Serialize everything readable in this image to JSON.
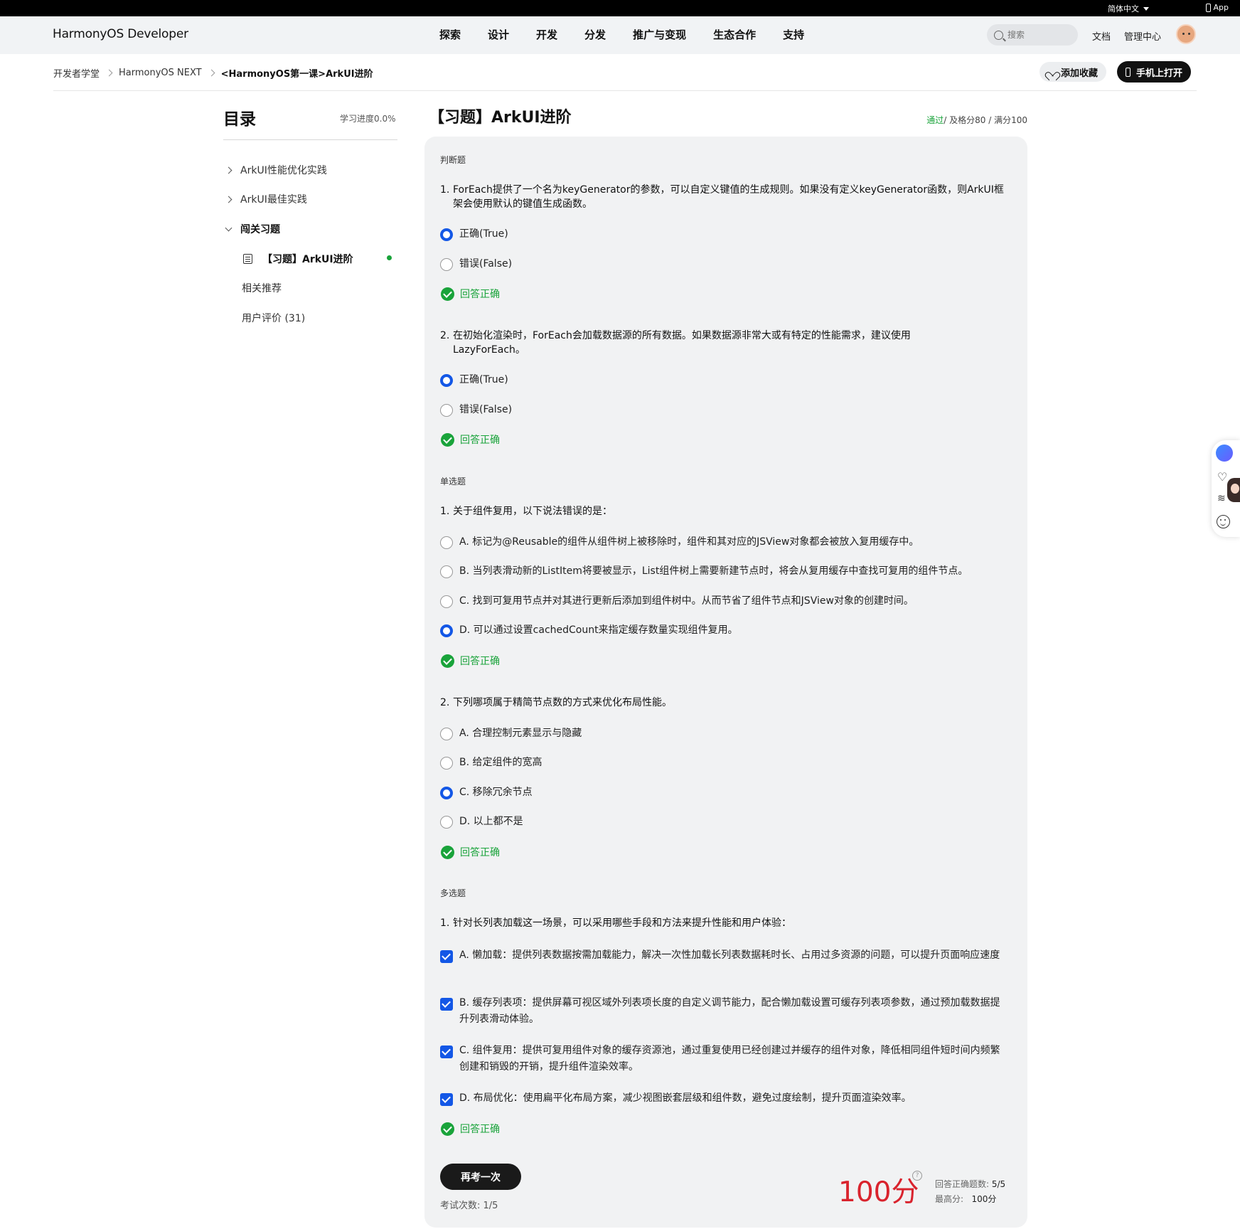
{
  "topbar": {
    "language": "简体中文",
    "app": "App"
  },
  "header": {
    "logo": "HarmonyOS Developer",
    "nav": [
      "探索",
      "设计",
      "开发",
      "分发",
      "推广与变现",
      "生态合作",
      "支持"
    ],
    "search_placeholder": "搜索",
    "docs": "文档",
    "admin": "管理中心"
  },
  "breadcrumb": [
    "开发者学堂",
    "HarmonyOS NEXT",
    "<HarmonyOS第一课>ArkUI进阶"
  ],
  "actions": {
    "favorite": "添加收藏",
    "open_mobile": "手机上打开"
  },
  "toc": {
    "title": "目录",
    "progress": "学习进度0.0%",
    "items": [
      {
        "label": "ArkUI性能优化实践"
      },
      {
        "label": "ArkUI最佳实践"
      },
      {
        "label": "闯关习题"
      },
      {
        "label": "【习题】ArkUI进阶"
      },
      {
        "label": "相关推荐"
      },
      {
        "label": "用户评价 (31)"
      }
    ]
  },
  "exam": {
    "title": "【习题】ArkUI进阶",
    "status": "通过",
    "pass_line": "/ 及格分80",
    "full_score": "/ 满分100",
    "correct_text": "回答正确",
    "sections": {
      "judge": "判断题",
      "single": "单选题",
      "multi": "多选题"
    },
    "questions": {
      "j1": {
        "num": "1.",
        "text": "ForEach提供了一个名为keyGenerator的参数，可以自定义键值的生成规则。如果没有定义keyGenerator函数，则ArkUI框架会使用默认的键值生成函数。",
        "options": [
          "正确(True)",
          "错误(False)"
        ]
      },
      "j2": {
        "num": "2.",
        "text": "在初始化渲染时，ForEach会加载数据源的所有数据。如果数据源非常大或有特定的性能需求，建议使用LazyForEach。",
        "options": [
          "正确(True)",
          "错误(False)"
        ]
      },
      "s1": {
        "num": "1.",
        "text": "关于组件复用，以下说法错误的是：",
        "options": [
          "A. 标记为@Reusable的组件从组件树上被移除时，组件和其对应的JSView对象都会被放入复用缓存中。",
          "B. 当列表滑动新的ListItem将要被显示，List组件树上需要新建节点时，将会从复用缓存中查找可复用的组件节点。",
          "C. 找到可复用节点并对其进行更新后添加到组件树中。从而节省了组件节点和JSView对象的创建时间。",
          "D. 可以通过设置cachedCount来指定缓存数量实现组件复用。"
        ]
      },
      "s2": {
        "num": "2.",
        "text": "下列哪项属于精简节点数的方式来优化布局性能。",
        "options": [
          "A. 合理控制元素显示与隐藏",
          "B. 给定组件的宽高",
          "C. 移除冗余节点",
          "D. 以上都不是"
        ]
      },
      "m1": {
        "num": "1.",
        "text": "针对长列表加载这一场景，可以采用哪些手段和方法来提升性能和用户体验：",
        "options": [
          "A. 懒加载：提供列表数据按需加载能力，解决一次性加载长列表数据耗时长、占用过多资源的问题，可以提升页面响应速度",
          "B. 缓存列表项：提供屏幕可视区域外列表项长度的自定义调节能力，配合懒加载设置可缓存列表项参数，通过预加载数据提升列表滑动体验。",
          "C. 组件复用：提供可复用组件对象的缓存资源池，通过重复使用已经创建过并缓存的组件对象，降低相同组件短时间内频繁创建和销毁的开销，提升组件渲染效率。",
          "D. 布局优化：使用扁平化布局方案，减少视图嵌套层级和组件数，避免过度绘制，提升页面渲染效率。"
        ]
      }
    },
    "retake": "再考一次",
    "attempts_label": "考试次数: 1/5",
    "score": "100分",
    "correct_count_label": "回答正确题数:",
    "correct_count": "5/5",
    "best_label": "最高分:",
    "best": "100分"
  }
}
